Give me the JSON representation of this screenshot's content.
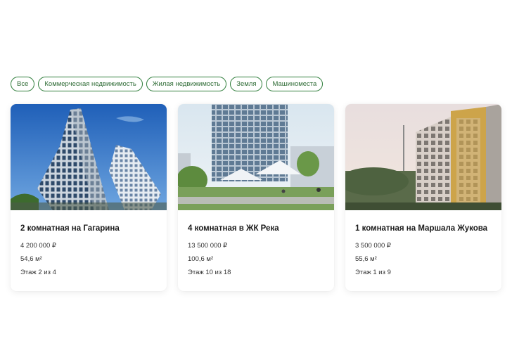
{
  "filters": [
    "Все",
    "Коммерческая недвижимость",
    "Жилая недвижимость",
    "Земля",
    "Машиноместа"
  ],
  "colors": {
    "accent": "#2e7d3a",
    "text": "#1a1a1a"
  },
  "cards": [
    {
      "title": "2 комнатная на Гагарина",
      "price": "4 200 000 ₽",
      "area": "54,6 м²",
      "floor": "Этаж 2 из 4",
      "image": "blue-sky-high-rise-photo"
    },
    {
      "title": "4 комнатная в ЖК Река",
      "price": "13 500 000 ₽",
      "area": "100,6 м²",
      "floor": "Этаж 10 из 18",
      "image": "residential-complex-courtyard-render"
    },
    {
      "title": "1 комнатная на Маршала Жукова",
      "price": "3 500 000 ₽",
      "area": "55,6 м²",
      "floor": "Этаж 1 из 9",
      "image": "sunset-building-with-tv-tower-photo"
    }
  ]
}
